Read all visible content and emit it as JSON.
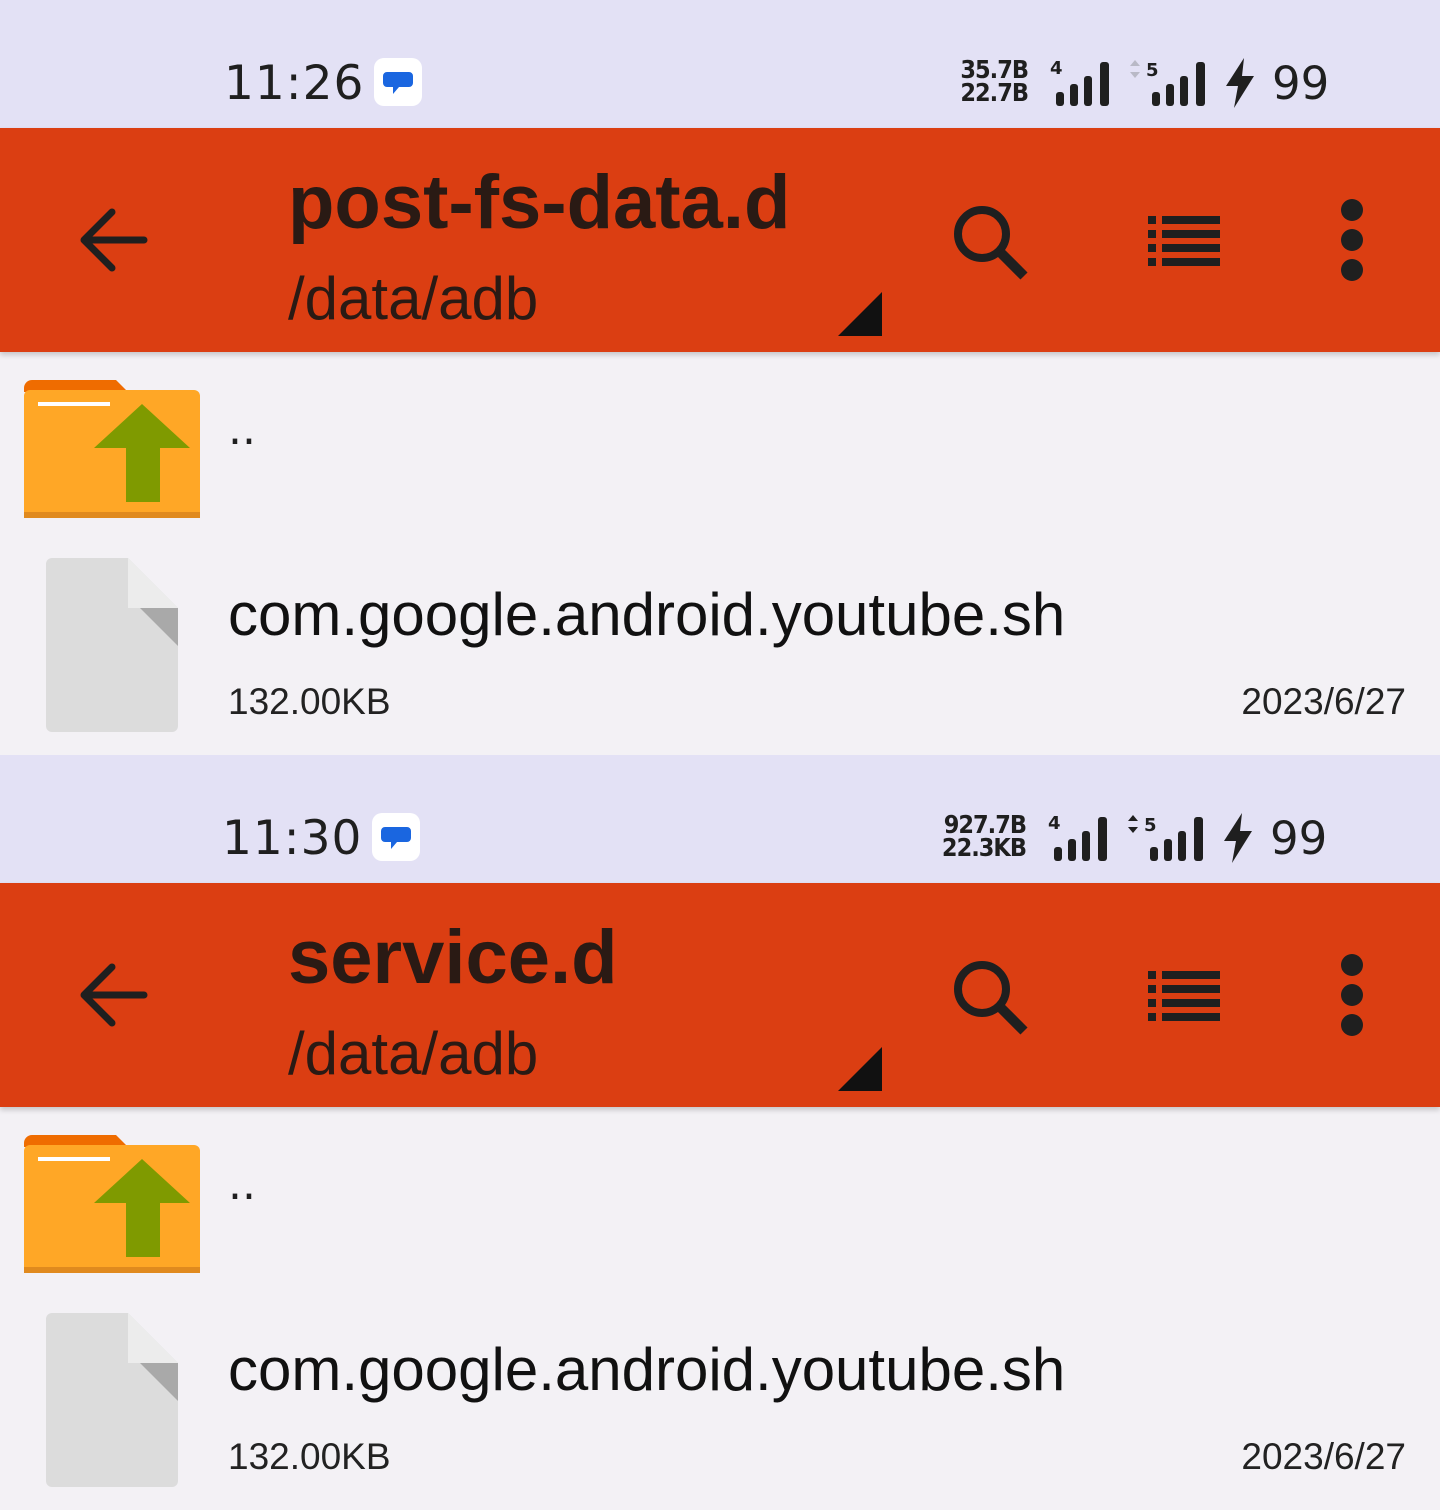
{
  "colors": {
    "status_bar_bg": "#e3e1f5",
    "app_bar_bg": "#db3e12",
    "content_bg": "#f3f1f5",
    "folder_orange": "#ffa726",
    "arrow_green": "#7f9a00"
  },
  "icons": {
    "back": "arrow-left-icon",
    "search": "search-icon",
    "view_mode": "list-view-icon",
    "more": "more-vertical-icon",
    "message": "message-icon",
    "signal": "cell-signal-icon",
    "charging": "charging-bolt-icon",
    "parent_folder": "folder-up-icon",
    "file": "file-icon"
  },
  "screens": [
    {
      "status": {
        "time": "11:26",
        "upload_speed": "35.7B",
        "download_speed": "22.7B",
        "sim1_label": "4",
        "sim2_label": "5",
        "battery": "99"
      },
      "header": {
        "title": "post-fs-data.d",
        "path": "/data/adb"
      },
      "parent_entry": "..",
      "files": [
        {
          "name": "com.google.android.youtube.sh",
          "size": "132.00KB",
          "date": "2023/6/27"
        }
      ]
    },
    {
      "status": {
        "time": "11:30",
        "upload_speed": "927.7B",
        "download_speed": "22.3KB",
        "sim1_label": "4",
        "sim2_label": "5",
        "battery": "99"
      },
      "header": {
        "title": "service.d",
        "path": "/data/adb"
      },
      "parent_entry": "..",
      "files": [
        {
          "name": "com.google.android.youtube.sh",
          "size": "132.00KB",
          "date": "2023/6/27"
        }
      ]
    }
  ]
}
